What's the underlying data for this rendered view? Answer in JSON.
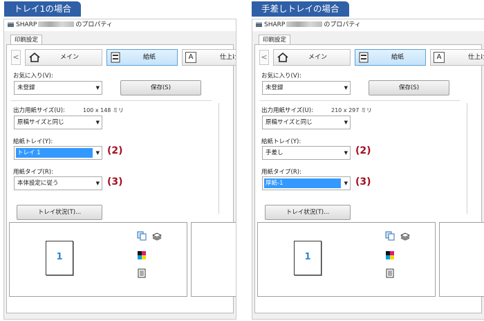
{
  "panels": [
    {
      "banner": "トレイ1の場合",
      "window_title_prefix": "SHARP",
      "window_title_suffix": "のプロパティ",
      "tab": "印刷設定",
      "nav": {
        "prev": "<",
        "main": "メイン",
        "paper": "給紙",
        "finishing": "仕上げ"
      },
      "favorites_label": "お気に入り(V):",
      "favorites_value": "未登録",
      "save_button": "保存(S)",
      "output_size_label": "出力用紙サイズ(U):",
      "output_size_value": "100 x 148 ミリ",
      "output_size_select": "原稿サイズと同じ",
      "paper_tray_label": "給紙トレイ(Y):",
      "paper_tray_value": "トレイ 1",
      "paper_type_label": "用紙タイプ(R):",
      "paper_type_value": "本体設定に従う",
      "tray_status_button": "トレイ状況(T)...",
      "annotation_2": "(2)",
      "annotation_3": "(3)",
      "preview_page": "1"
    },
    {
      "banner": "手差しトレイの場合",
      "window_title_prefix": "SHARP",
      "window_title_suffix": "のプロパティ",
      "tab": "印刷設定",
      "nav": {
        "prev": "<",
        "main": "メイン",
        "paper": "給紙",
        "finishing": "仕上げ"
      },
      "favorites_label": "お気に入り(V):",
      "favorites_value": "未登録",
      "save_button": "保存(S)",
      "output_size_label": "出力用紙サイズ(U):",
      "output_size_value": "210 x 297 ミリ",
      "output_size_select": "原稿サイズと同じ",
      "paper_tray_label": "給紙トレイ(Y):",
      "paper_tray_value": "手差し",
      "paper_type_label": "用紙タイプ(R):",
      "paper_type_value": "厚紙-1",
      "tray_status_button": "トレイ状況(T)...",
      "annotation_2": "(2)",
      "annotation_3": "(3)",
      "preview_page": "1"
    }
  ],
  "colors": {
    "banner": "#2f5fa6",
    "selection": "#3399ff",
    "annotation": "#a30f1f",
    "page_number": "#2e86d4"
  }
}
